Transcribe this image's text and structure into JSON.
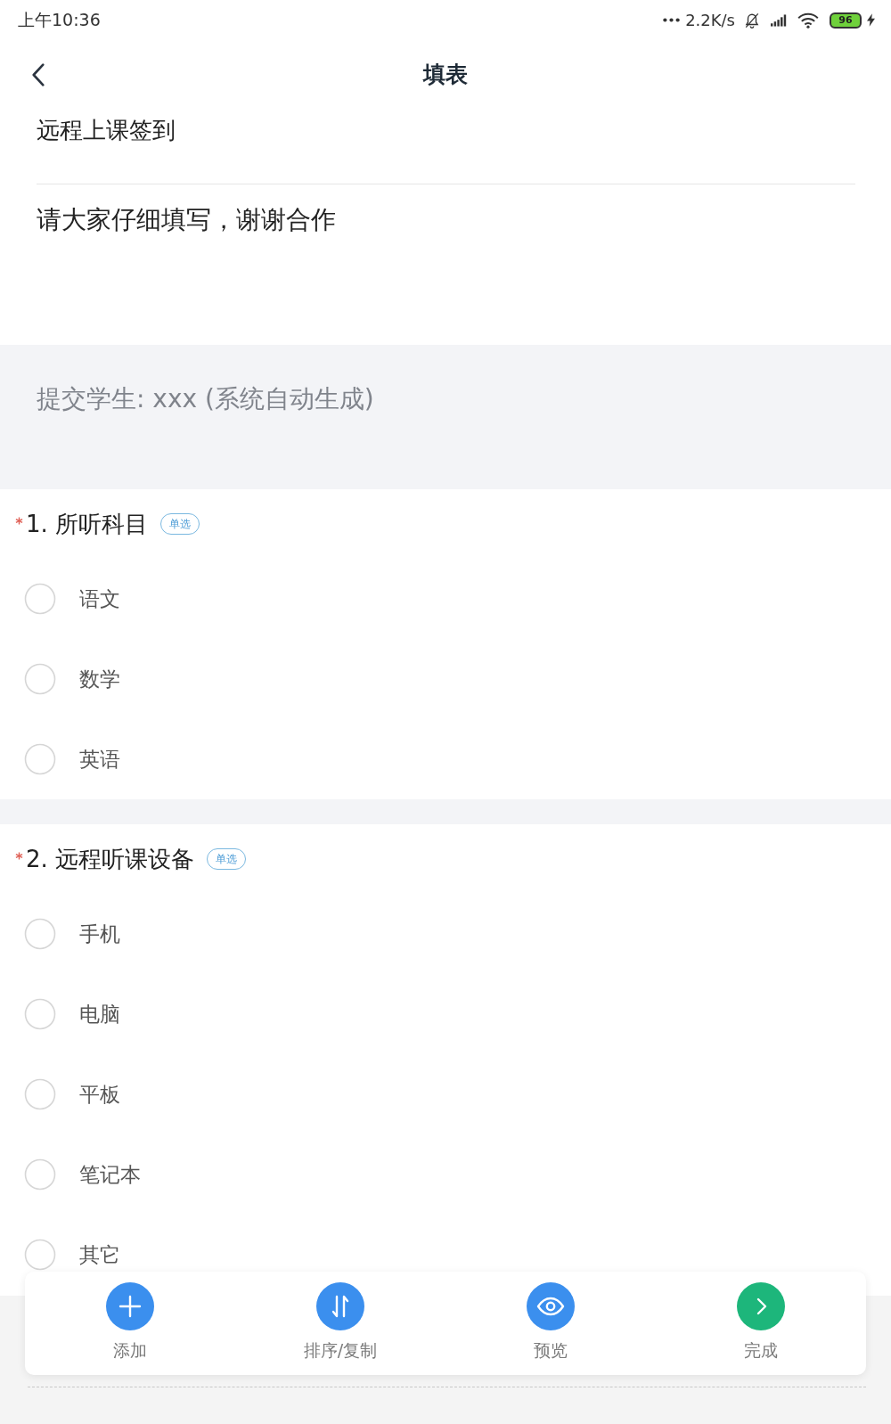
{
  "status_bar": {
    "time": "上午10:36",
    "network_speed": "2.2K/s",
    "battery": "96"
  },
  "nav": {
    "title": "填表"
  },
  "form": {
    "title": "远程上课签到",
    "description": "请大家仔细填写，谢谢合作"
  },
  "submitter_note": "提交学生: xxx (系统自动生成)",
  "questions": [
    {
      "required": true,
      "title": "1. 所听科目",
      "type_label": "单选",
      "options": [
        {
          "label": "语文",
          "selected": false
        },
        {
          "label": "数学",
          "selected": false
        },
        {
          "label": "英语",
          "selected": false
        }
      ]
    },
    {
      "required": true,
      "title": "2. 远程听课设备",
      "type_label": "单选",
      "options": [
        {
          "label": "手机",
          "selected": false
        },
        {
          "label": "电脑",
          "selected": false
        },
        {
          "label": "平板",
          "selected": false
        },
        {
          "label": "笔记本",
          "selected": false
        },
        {
          "label": "其它",
          "selected": false
        }
      ]
    }
  ],
  "toolbar": [
    {
      "kind": "add",
      "label": "添加",
      "color": "#3b8fee"
    },
    {
      "kind": "sort",
      "label": "排序/复制",
      "color": "#3b8fee"
    },
    {
      "kind": "preview",
      "label": "预览",
      "color": "#3b8fee"
    },
    {
      "kind": "finish",
      "label": "完成",
      "color": "#1db67b"
    }
  ]
}
